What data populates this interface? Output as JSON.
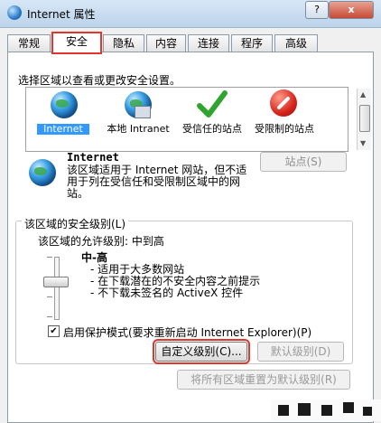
{
  "window": {
    "title": "Internet 属性",
    "help": "?",
    "close": "x"
  },
  "tabs": [
    "常规",
    "安全",
    "隐私",
    "内容",
    "连接",
    "程序",
    "高级"
  ],
  "instruction": "选择区域以查看或更改安全设置。",
  "zones": [
    {
      "label": "Internet",
      "icon": "globe-icon"
    },
    {
      "label": "本地 Intranet",
      "icon": "local-intranet-icon"
    },
    {
      "label": "受信任的站点",
      "icon": "check-icon"
    },
    {
      "label": "受限制的站点",
      "icon": "stop-icon"
    }
  ],
  "selected_zone": {
    "name": "Internet",
    "description": "该区域适用于 Internet 网站，但不适用于列在受信任和受限制区域中的网站。",
    "sites_button": "站点(S)"
  },
  "security": {
    "group_title": "该区域的安全级别(L)",
    "allowed_levels": "该区域的允许级别: 中到高",
    "level_name": "中-高",
    "bullets": [
      "- 适用于大多数网站",
      "- 在下载潜在的不安全内容之前提示",
      "- 不下载未签名的 ActiveX 控件"
    ],
    "protected_mode_label": "启用保护模式(要求重新启动 Internet Explorer)(P)",
    "protected_mode_checked": "✔",
    "custom_level_button": "自定义级别(C)...",
    "default_level_button": "默认级别(D)"
  },
  "reset_all_button": "将所有区域重置为默认级别(R)",
  "colors": {
    "highlight_red": "#e0362c",
    "selection_blue": "#3399ff"
  }
}
